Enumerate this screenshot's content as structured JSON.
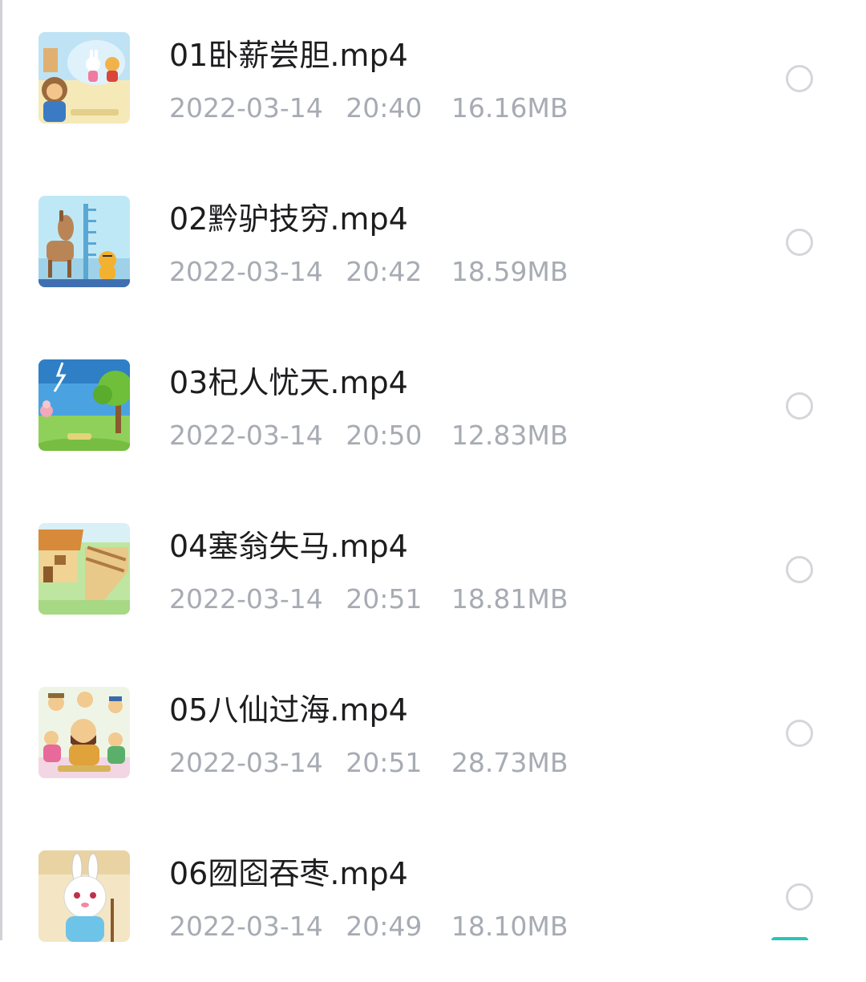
{
  "files": [
    {
      "name": "01卧薪尝胆.mp4",
      "date": "2022-03-14",
      "time": "20:40",
      "size": "16.16MB",
      "thumbnail": "idiom-cartoon-rabbit-tiger-thumbnail"
    },
    {
      "name": "02黔驴技穷.mp4",
      "date": "2022-03-14",
      "time": "20:42",
      "size": "18.59MB",
      "thumbnail": "idiom-cartoon-donkey-tiger-thumbnail"
    },
    {
      "name": "03杞人忧天.mp4",
      "date": "2022-03-14",
      "time": "20:50",
      "size": "12.83MB",
      "thumbnail": "idiom-cartoon-sky-tree-thumbnail"
    },
    {
      "name": "04塞翁失马.mp4",
      "date": "2022-03-14",
      "time": "20:51",
      "size": "18.81MB",
      "thumbnail": "idiom-cartoon-farmhouse-thumbnail"
    },
    {
      "name": "05八仙过海.mp4",
      "date": "2022-03-14",
      "time": "20:51",
      "size": "28.73MB",
      "thumbnail": "idiom-cartoon-eight-immortals-thumbnail"
    },
    {
      "name": "06囫囵吞枣.mp4",
      "date": "2022-03-14",
      "time": "20:49",
      "size": "18.10MB",
      "thumbnail": "idiom-cartoon-rabbit-thumbnail"
    }
  ],
  "colors": {
    "name_text": "#1d1d1f",
    "meta_text": "#a7abb3",
    "radio_border": "#d4d6da",
    "accent": "#29c6b7"
  }
}
